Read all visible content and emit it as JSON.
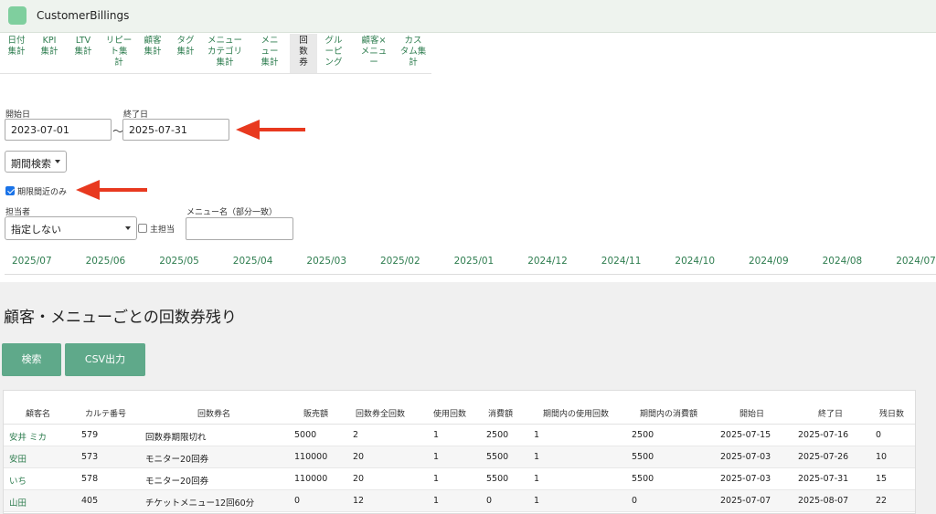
{
  "app": {
    "title": "CustomerBillings"
  },
  "nav": {
    "tabs": [
      {
        "lines": [
          "日付",
          "集計"
        ]
      },
      {
        "lines": [
          "KPI",
          "集計"
        ]
      },
      {
        "lines": [
          "LTV",
          "集計"
        ]
      },
      {
        "lines": [
          "リピー",
          "ト集",
          "計"
        ]
      },
      {
        "lines": [
          "顧客",
          "集計"
        ]
      },
      {
        "lines": [
          "タグ",
          "集計"
        ]
      },
      {
        "lines": [
          "メニュー",
          "カテゴリ",
          "集計"
        ]
      },
      {
        "lines": [
          "メニ",
          "ュー",
          "集計"
        ]
      },
      {
        "lines": [
          "回",
          "数",
          "券"
        ]
      },
      {
        "lines": [
          "グル",
          "ーピ",
          "ング"
        ]
      },
      {
        "lines": [
          "顧客×",
          "メニュ",
          "ー"
        ]
      },
      {
        "lines": [
          "カス",
          "タム集",
          "計"
        ]
      }
    ],
    "active_index": 8
  },
  "filters": {
    "start_label": "開始日",
    "start_value": "2023-07-01",
    "tilde": "〜",
    "end_label": "終了日",
    "end_value": "2025-07-31",
    "period_button": "期間検索",
    "near_expiry_label": "期限間近のみ",
    "near_expiry_checked": true,
    "staff_label": "担当者",
    "staff_selected": "指定しない",
    "main_staff_label": "主担当",
    "main_staff_checked": false,
    "menu_name_label": "メニュー名（部分一致）",
    "menu_name_value": ""
  },
  "months": [
    "2025/07",
    "2025/06",
    "2025/05",
    "2025/04",
    "2025/03",
    "2025/02",
    "2025/01",
    "2024/12",
    "2024/11",
    "2024/10",
    "2024/09",
    "2024/08",
    "2024/07"
  ],
  "section": {
    "title": "顧客・メニューごとの回数券残り",
    "search_button": "検索",
    "csv_button": "CSV出力"
  },
  "table": {
    "headers": [
      "顧客名",
      "カルテ番号",
      "回数券名",
      "販売額",
      "回数券全回数",
      "使用回数",
      "消費額",
      "期間内の使用回数",
      "期間内の消費額",
      "開始日",
      "終了日",
      "残日数"
    ],
    "rows": [
      [
        "安井 ミカ",
        "579",
        "回数券期限切れ",
        "5000",
        "2",
        "1",
        "2500",
        "1",
        "2500",
        "2025-07-15",
        "2025-07-16",
        "0"
      ],
      [
        "安田",
        "573",
        "モニター20回券",
        "110000",
        "20",
        "1",
        "5500",
        "1",
        "5500",
        "2025-07-03",
        "2025-07-26",
        "10"
      ],
      [
        "いち",
        "578",
        "モニター20回券",
        "110000",
        "20",
        "1",
        "5500",
        "1",
        "5500",
        "2025-07-03",
        "2025-07-31",
        "15"
      ],
      [
        "山田",
        "405",
        "チケットメニュー12回60分",
        "0",
        "12",
        "1",
        "0",
        "1",
        "0",
        "2025-07-07",
        "2025-08-07",
        "22"
      ]
    ]
  },
  "colors": {
    "accent": "#5fa98a",
    "link": "#2e7d4f",
    "arrow": "#e8391f",
    "checkbox": "#1a73e8"
  }
}
